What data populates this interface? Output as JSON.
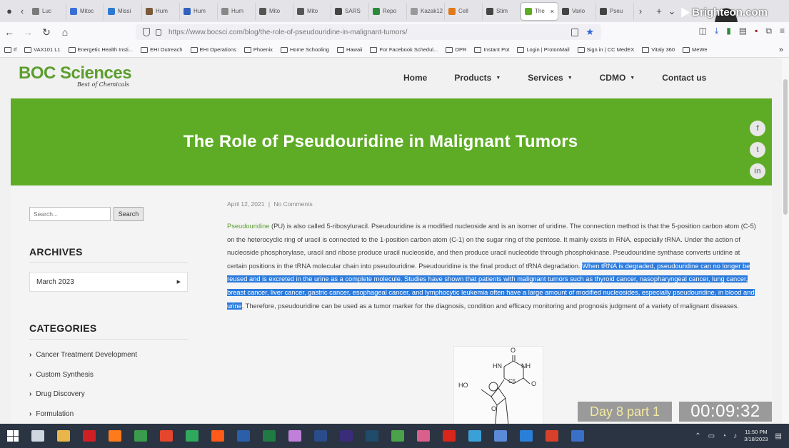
{
  "browser": {
    "tabs": [
      {
        "label": "Luc",
        "color": "#7a7a7a"
      },
      {
        "label": "Mitoc",
        "color": "#3b6fd8"
      },
      {
        "label": "Missi",
        "color": "#2d7ad3"
      },
      {
        "label": "Hum",
        "color": "#7a5a3a"
      },
      {
        "label": "Hum",
        "color": "#3060c0"
      },
      {
        "label": "Hum",
        "color": "#888888"
      },
      {
        "label": "Mito",
        "color": "#555555"
      },
      {
        "label": "Mito",
        "color": "#555555"
      },
      {
        "label": "SARS",
        "color": "#444444"
      },
      {
        "label": "Repo",
        "color": "#2a8a3a"
      },
      {
        "label": "Kazak12",
        "color": "#999999"
      },
      {
        "label": "Cell",
        "color": "#e07a1a"
      },
      {
        "label": "Stim",
        "color": "#444444"
      },
      {
        "label": "The",
        "color": "#5eac25",
        "active": true
      },
      {
        "label": "Vario",
        "color": "#444444"
      },
      {
        "label": "Pseu",
        "color": "#444444"
      }
    ],
    "overlay_brand": "Brighteon.com",
    "url": "https://www.bocsci.com/blog/the-role-of-pseudouridine-in-malignant-tumors/",
    "bookmarks": [
      "If",
      "VAX101 L1",
      "Energetic Health Insti...",
      "EHI Outreach",
      "EHI Operations",
      "Phoenix",
      "Home Schooling",
      "Hawaii",
      "For Facebook Schedul...",
      "OPR",
      "Instant Pot",
      "Login | ProtonMail",
      "Sign in | CC MedEX",
      "Vitaly 360",
      "MeWe"
    ]
  },
  "site": {
    "brand": "BOC Sciences",
    "tagline": "Best of Chemicals",
    "nav": [
      {
        "label": "Home",
        "dropdown": false
      },
      {
        "label": "Products",
        "dropdown": true
      },
      {
        "label": "Services",
        "dropdown": true
      },
      {
        "label": "CDMO",
        "dropdown": true
      },
      {
        "label": "Contact us",
        "dropdown": false
      }
    ],
    "hero_title": "The Role of Pseudouridine in Malignant Tumors",
    "hero_color": "#5eac25",
    "social": [
      "f",
      "t",
      "in"
    ]
  },
  "sidebar": {
    "search_placeholder": "Search...",
    "search_button": "Search",
    "archives_heading": "ARCHIVES",
    "archive_selected": "March 2023",
    "categories_heading": "CATEGORIES",
    "categories": [
      "Cancer Treatment Development",
      "Custom Synthesis",
      "Drug Discovery",
      "Formulation"
    ]
  },
  "article": {
    "date": "April 12, 2021",
    "separator": "|",
    "comments": "No Comments",
    "link_word": "Pseudouridine",
    "text_before": " (PU) is also called 5-ribosyluracil. Pseudouridine is a modified nucleoside and is an isomer of uridine. The connection method is that the 5-position carbon atom (C-5) on the heterocyclic ring of uracil is connected to the 1-position carbon atom (C-1) on the sugar ring of the pentose. It mainly exists in RNA, especially tRNA. Under the action of nucleoside phosphorylase, uracil and ribose produce uracil nucleoside, and then produce uracil nucleotide through phosphokinase. Pseudouridine synthase converts uridine at certain positions in the tRNA molecular chain into pseudouridine. Pseudouridine is the final product of tRNA degradation. ",
    "text_highlight": "When tRNA is degraded, pseudouridine can no longer be reused and is excreted in the urine as a complete molecule. Studies have shown that patients with malignant tumors such as thyroid cancer, nasopharyngeal cancer, lung cancer, breast cancer, liver cancer, gastric cancer, esophageal cancer, and lymphocytic leukemia often have a large amount of modified nucleosides, especially pseudouridine, in blood and urine",
    "text_after": ". Therefore, pseudouridine can be used as a tumor marker for the diagnosis, condition and efficacy monitoring and prognosis judgment of a variety of malignant diseases.",
    "molecule_labels": {
      "o_top": "O",
      "hn": "HN",
      "nh": "NH",
      "o_right": "O",
      "c5": "C5",
      "ho": "HO",
      "o_ring": "O"
    }
  },
  "video_overlay": {
    "day_label": "Day 8 part 1",
    "timestamp": "00:09:32"
  },
  "taskbar": {
    "apps": [
      {
        "name": "task-view",
        "color": "#cfd6df"
      },
      {
        "name": "file-explorer",
        "color": "#e8b64a"
      },
      {
        "name": "netflix",
        "color": "#d11f26"
      },
      {
        "name": "firefox",
        "color": "#ff7a1a"
      },
      {
        "name": "chrome",
        "color": "#3a9b4c"
      },
      {
        "name": "chrome-alt",
        "color": "#e6462d"
      },
      {
        "name": "green-app",
        "color": "#2faa5d"
      },
      {
        "name": "firefox-alt",
        "color": "#ff5a1a"
      },
      {
        "name": "word",
        "color": "#2b5faa"
      },
      {
        "name": "excel",
        "color": "#1f7a43"
      },
      {
        "name": "gem-app",
        "color": "#c07fd8"
      },
      {
        "name": "photoshop",
        "color": "#2a4c8a"
      },
      {
        "name": "premiere",
        "color": "#3b2c7a"
      },
      {
        "name": "audition",
        "color": "#1f4c6a"
      },
      {
        "name": "camtasia",
        "color": "#4aa34a"
      },
      {
        "name": "photos",
        "color": "#d8608a"
      },
      {
        "name": "acrobat",
        "color": "#d8261a"
      },
      {
        "name": "blue-app",
        "color": "#3aa0d8"
      },
      {
        "name": "chart-app",
        "color": "#5a8ad8"
      },
      {
        "name": "cloud-app",
        "color": "#2a80d8"
      },
      {
        "name": "red-app",
        "color": "#d8402a"
      },
      {
        "name": "r-app",
        "color": "#3a70c8"
      }
    ],
    "time": "11:50 PM",
    "date": "3/18/2023"
  }
}
